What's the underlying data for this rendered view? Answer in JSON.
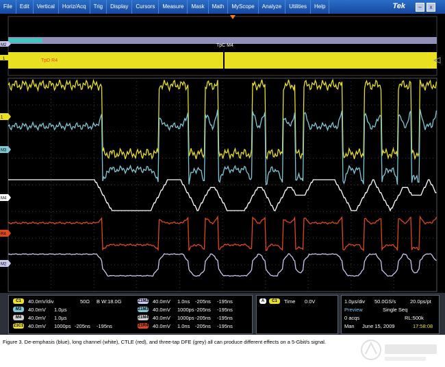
{
  "menu": [
    "File",
    "Edit",
    "Vertical",
    "Horiz/Acq",
    "Trig",
    "Display",
    "Cursors",
    "Measure",
    "Mask",
    "Math",
    "MyScope",
    "Analyze",
    "Utilities",
    "Help"
  ],
  "brand": "Tek",
  "overview": {
    "tpc_label": "TpC M4",
    "tpd_label": "TpD R4",
    "marker_m2": "M2",
    "marker_1": "1"
  },
  "channel_markers": [
    "1",
    "M3",
    "M4",
    "R4",
    "M2"
  ],
  "colors": {
    "ch1": "#e8e020",
    "m3": "#7fc8d8",
    "m4": "#ffffff",
    "r4": "#e04818",
    "m2": "#c8c8f0",
    "trigger": "#f08020"
  },
  "settings": {
    "c1": {
      "badge": "C1",
      "scale": "40.0mV/div",
      "impedance": "50Ω",
      "bw": "B W:18.0G"
    },
    "m3": {
      "badge": "M3",
      "scale": "40.0mV",
      "time": "1.0µs"
    },
    "m4": {
      "badge": "M4",
      "scale": "40.0mV",
      "time": "1.0µs"
    },
    "zc1": {
      "badge": "Z1C1",
      "scale": "40.0mV",
      "time": "1000ps",
      "pos1": "-205ns",
      "pos2": "-195ns"
    },
    "zm2": {
      "badge": "Z1M2",
      "scale": "40.0mV",
      "time": "1.0ns",
      "pos1": "-205ns",
      "pos2": "-195ns"
    },
    "zm3": {
      "badge": "Z1M3",
      "scale": "40.0mV",
      "time": "1000ps",
      "pos1": "-205ns",
      "pos2": "-195ns"
    },
    "zm4": {
      "badge": "Z1M4",
      "scale": "40.0mV",
      "time": "1000ps",
      "pos1": "-205ns",
      "pos2": "-195ns"
    },
    "zr4": {
      "badge": "Z1R4",
      "scale": "40.0mV",
      "time": "1.0ns",
      "pos1": "-205ns",
      "pos2": "-195ns"
    }
  },
  "trigger": {
    "a": "A",
    "src": "C1",
    "label": "Time",
    "value": "0.0V"
  },
  "acquisition": {
    "timebase": "1.0µs/div",
    "rate": "50.0GS/s",
    "res": "20.0ps/pt",
    "preview": "Preview",
    "mode": "Single Seq",
    "acqs": "0 acqs",
    "rl": "RL:500k",
    "man": "Man",
    "date": "June 15, 2009",
    "time": "17:58:08"
  },
  "caption": "Figure 3. De-emphasis (blue), long channel (white), CTLE (red), and three-tap DFE (grey) all can produce different effects on a 5-Gbit/s signal."
}
